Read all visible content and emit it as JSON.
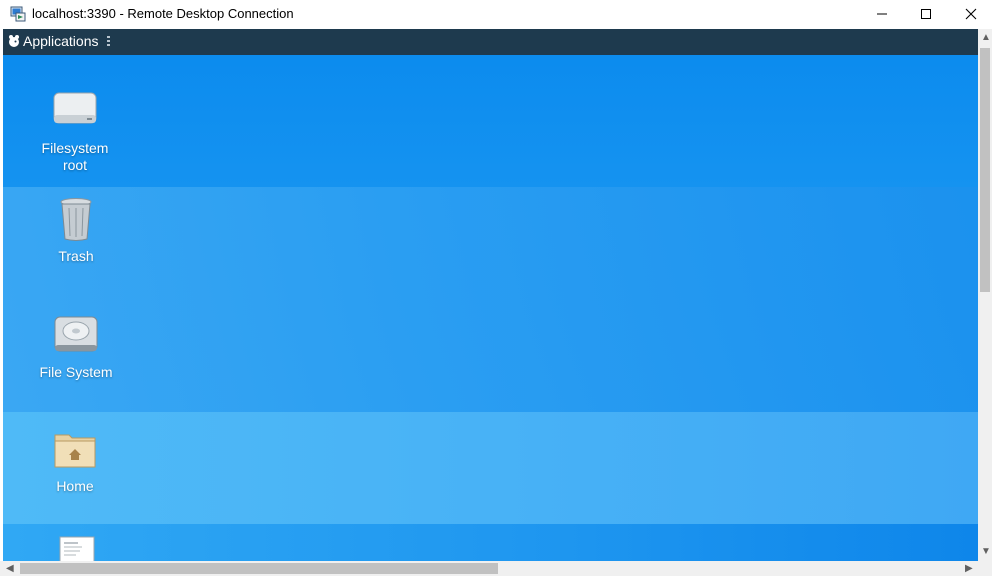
{
  "window": {
    "title": "localhost:3390 - Remote Desktop Connection"
  },
  "panel": {
    "applications_label": "Applications"
  },
  "desktop_icons": [
    {
      "label_line1": "Filesystem",
      "label_line2": "root",
      "icon": "drive-icon"
    },
    {
      "label_line1": "Trash",
      "icon": "trash-icon"
    },
    {
      "label_line1": "File System",
      "icon": "harddisk-icon"
    },
    {
      "label_line1": "Home",
      "icon": "home-folder-icon"
    },
    {
      "icon": "document-icon"
    }
  ],
  "colors": {
    "panel": "#1e3a4e",
    "wallpaper_primary": "#0a86ea",
    "wallpaper_light": "#4fbaf7"
  }
}
